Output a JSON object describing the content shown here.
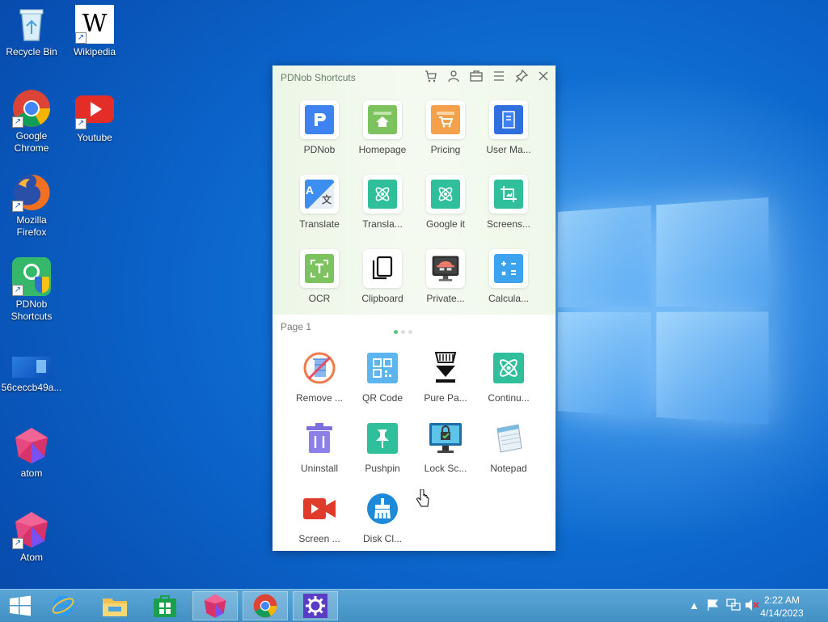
{
  "desktop": {
    "icons": [
      {
        "label": "Recycle Bin"
      },
      {
        "label": "Wikipedia"
      },
      {
        "label": "Google Chrome"
      },
      {
        "label": "Youtube"
      },
      {
        "label": "Mozilla Firefox"
      },
      {
        "label": "PDNob Shortcuts"
      },
      {
        "label": "56ceccb49a..."
      },
      {
        "label": "atom"
      },
      {
        "label": "Atom"
      }
    ]
  },
  "pdnob": {
    "title": "PDNob Shortcuts",
    "toolbar_icons": [
      "cart-icon",
      "user-icon",
      "toolbox-icon",
      "menu-icon",
      "pin-icon",
      "close-icon"
    ],
    "top_tiles": [
      {
        "label": "PDNob",
        "icon": "pdnob-logo-icon",
        "color": "#3d82f0"
      },
      {
        "label": "Homepage",
        "icon": "home-icon",
        "color": "#7cc35f"
      },
      {
        "label": "Pricing",
        "icon": "cart-icon",
        "color": "#f5a04a"
      },
      {
        "label": "User Ma...",
        "icon": "manual-icon",
        "color": "#2f6fe0"
      },
      {
        "label": "Translate",
        "icon": "translate-icon",
        "color": "#3c8ff0"
      },
      {
        "label": "Transla...",
        "icon": "atom-icon",
        "color": "#2fbf9a"
      },
      {
        "label": "Google it",
        "icon": "atom-icon",
        "color": "#2fbf9a"
      },
      {
        "label": "Screens...",
        "icon": "crop-icon",
        "color": "#2fbf9a"
      },
      {
        "label": "OCR",
        "icon": "ocr-icon",
        "color": "#7cc35f"
      },
      {
        "label": "Clipboard",
        "icon": "clipboard-icon",
        "color": "#ffffff"
      },
      {
        "label": "Private...",
        "icon": "incognito-monitor-icon",
        "color": "#333333"
      },
      {
        "label": "Calcula...",
        "icon": "calculator-icon",
        "color": "#3ea3ee"
      }
    ],
    "page_label": "Page 1",
    "page_dots": 3,
    "bottom_tiles": [
      {
        "label": "Remove ...",
        "icon": "remove-icon"
      },
      {
        "label": "QR Code",
        "icon": "qr-code-icon"
      },
      {
        "label": "Pure Pa...",
        "icon": "pure-paste-icon"
      },
      {
        "label": "Continu...",
        "icon": "atom-icon"
      },
      {
        "label": "Uninstall",
        "icon": "trash-icon"
      },
      {
        "label": "Pushpin",
        "icon": "pushpin-icon"
      },
      {
        "label": "Lock Sc...",
        "icon": "lock-screen-icon"
      },
      {
        "label": "Notepad",
        "icon": "notepad-icon"
      },
      {
        "label": "Screen ...",
        "icon": "screen-record-icon"
      },
      {
        "label": "Disk Cl...",
        "icon": "disk-clean-icon"
      }
    ]
  },
  "taskbar": {
    "apps": [
      "start-button",
      "internet-explorer",
      "file-explorer",
      "store",
      "atom",
      "chrome",
      "settings"
    ],
    "time": "2:22 AM",
    "date": "4/14/2023"
  }
}
